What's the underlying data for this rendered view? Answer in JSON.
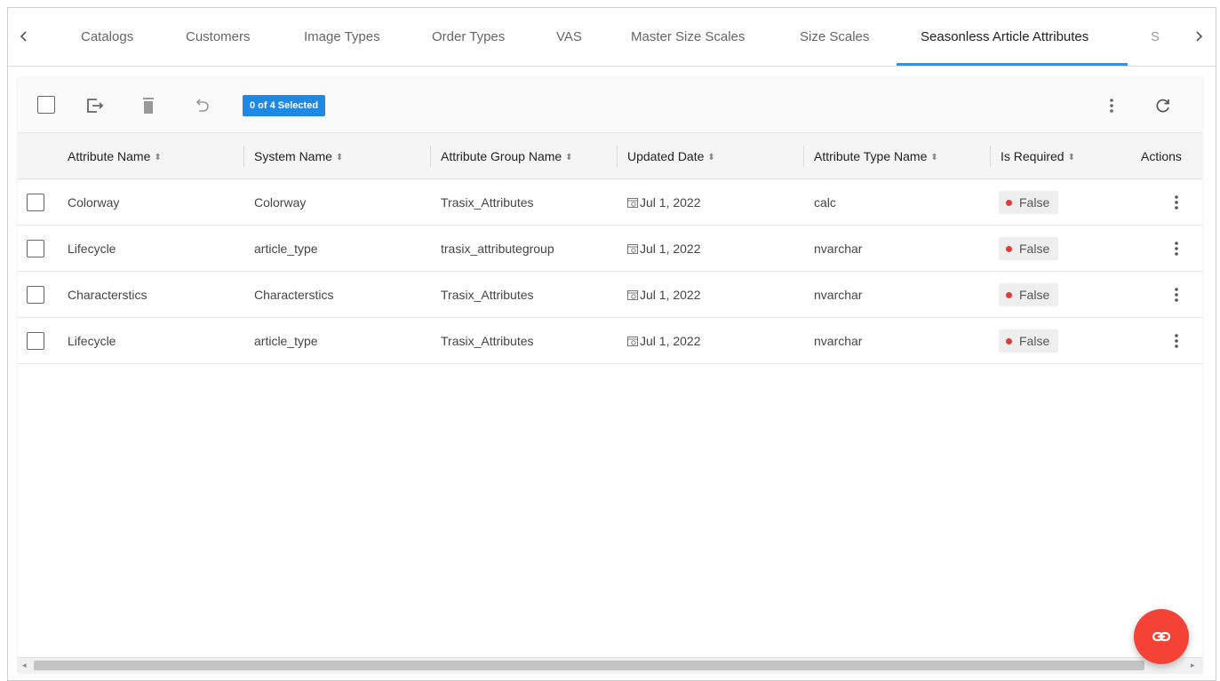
{
  "tabs": {
    "items": [
      {
        "label": "Catalogs"
      },
      {
        "label": "Customers"
      },
      {
        "label": "Image Types"
      },
      {
        "label": "Order Types"
      },
      {
        "label": "VAS"
      },
      {
        "label": "Master Size Scales"
      },
      {
        "label": "Size Scales"
      },
      {
        "label": "Seasonless Article Attributes"
      },
      {
        "label": "S"
      }
    ],
    "active_index": 7
  },
  "toolbar": {
    "selection_badge": "0 of 4 Selected"
  },
  "table": {
    "headers": {
      "attribute_name": "Attribute Name",
      "system_name": "System Name",
      "attribute_group_name": "Attribute Group Name",
      "updated_date": "Updated Date",
      "attribute_type_name": "Attribute Type Name",
      "is_required": "Is Required",
      "actions": "Actions"
    },
    "rows": [
      {
        "attribute_name": "Colorway",
        "system_name": "Colorway",
        "attribute_group_name": "Trasix_Attributes",
        "updated_date": "Jul 1, 2022",
        "attribute_type_name": "calc",
        "is_required": "False"
      },
      {
        "attribute_name": "Lifecycle",
        "system_name": "article_type",
        "attribute_group_name": "trasix_attributegroup",
        "updated_date": "Jul 1, 2022",
        "attribute_type_name": "nvarchar",
        "is_required": "False"
      },
      {
        "attribute_name": "Characterstics",
        "system_name": "Characterstics",
        "attribute_group_name": "Trasix_Attributes",
        "updated_date": "Jul 1, 2022",
        "attribute_type_name": "nvarchar",
        "is_required": "False"
      },
      {
        "attribute_name": "Lifecycle",
        "system_name": "article_type",
        "attribute_group_name": "Trasix_Attributes",
        "updated_date": "Jul 1, 2022",
        "attribute_type_name": "nvarchar",
        "is_required": "False"
      }
    ]
  },
  "colors": {
    "accent": "#2196f3",
    "badge_bg": "#1e88e5",
    "status_false": "#e53935",
    "fab": "#f44336"
  },
  "icons": {
    "tab_prev": "chevron-left-icon",
    "tab_next": "chevron-right-icon",
    "export": "export-icon",
    "delete": "trash-icon",
    "undo": "undo-icon",
    "more": "more-vert-icon",
    "refresh": "refresh-icon",
    "date": "calendar-icon",
    "fab": "link-icon"
  }
}
